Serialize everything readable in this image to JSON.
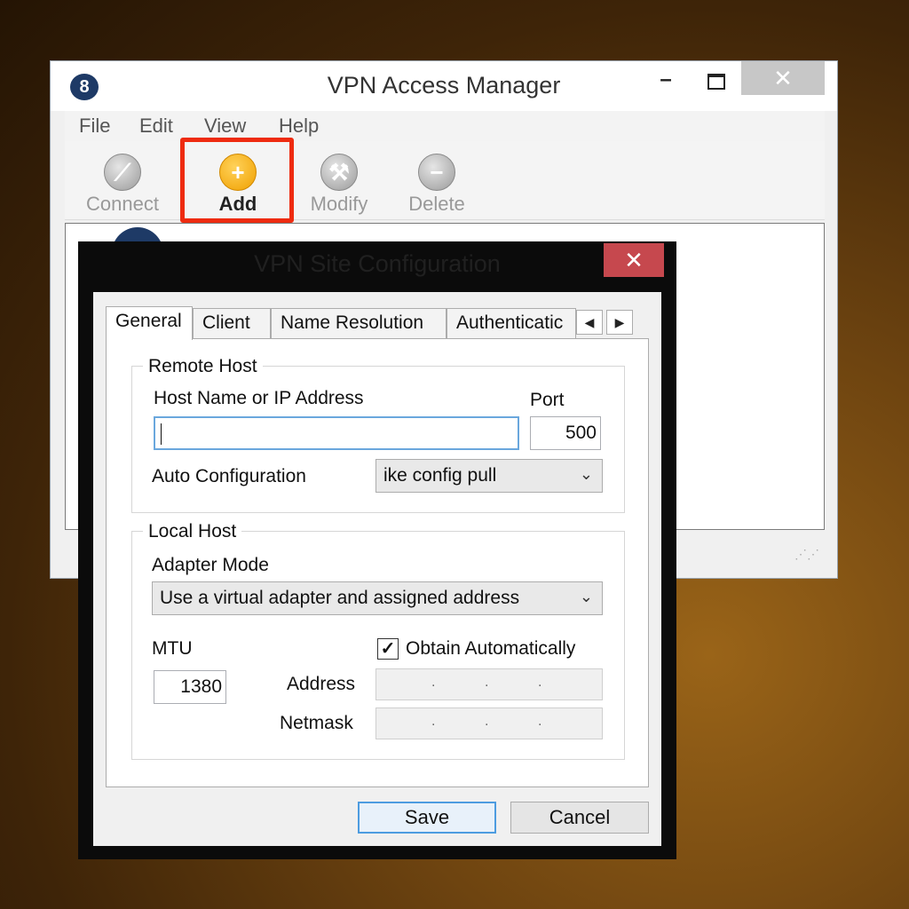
{
  "main_window": {
    "title": "VPN Access Manager",
    "menu": [
      "File",
      "Edit",
      "View",
      "Help"
    ],
    "toolbar": {
      "connect": "Connect",
      "add": "Add",
      "modify": "Modify",
      "delete": "Delete"
    },
    "highlight_color": "#ee2b10"
  },
  "dialog": {
    "title": "VPN Site Configuration",
    "tabs": [
      "General",
      "Client",
      "Name Resolution",
      "Authenticatic"
    ],
    "active_tab": "General",
    "remote_host": {
      "group_label": "Remote Host",
      "host_label": "Host Name or IP Address",
      "host_value": "",
      "port_label": "Port",
      "port_value": "500",
      "auto_config_label": "Auto Configuration",
      "auto_config_value": "ike config pull"
    },
    "local_host": {
      "group_label": "Local Host",
      "adapter_mode_label": "Adapter Mode",
      "adapter_mode_value": "Use a virtual adapter and assigned address",
      "mtu_label": "MTU",
      "mtu_value": "1380",
      "obtain_auto_label": "Obtain Automatically",
      "obtain_auto_checked": true,
      "address_label": "Address",
      "netmask_label": "Netmask"
    },
    "buttons": {
      "save": "Save",
      "cancel": "Cancel"
    }
  }
}
